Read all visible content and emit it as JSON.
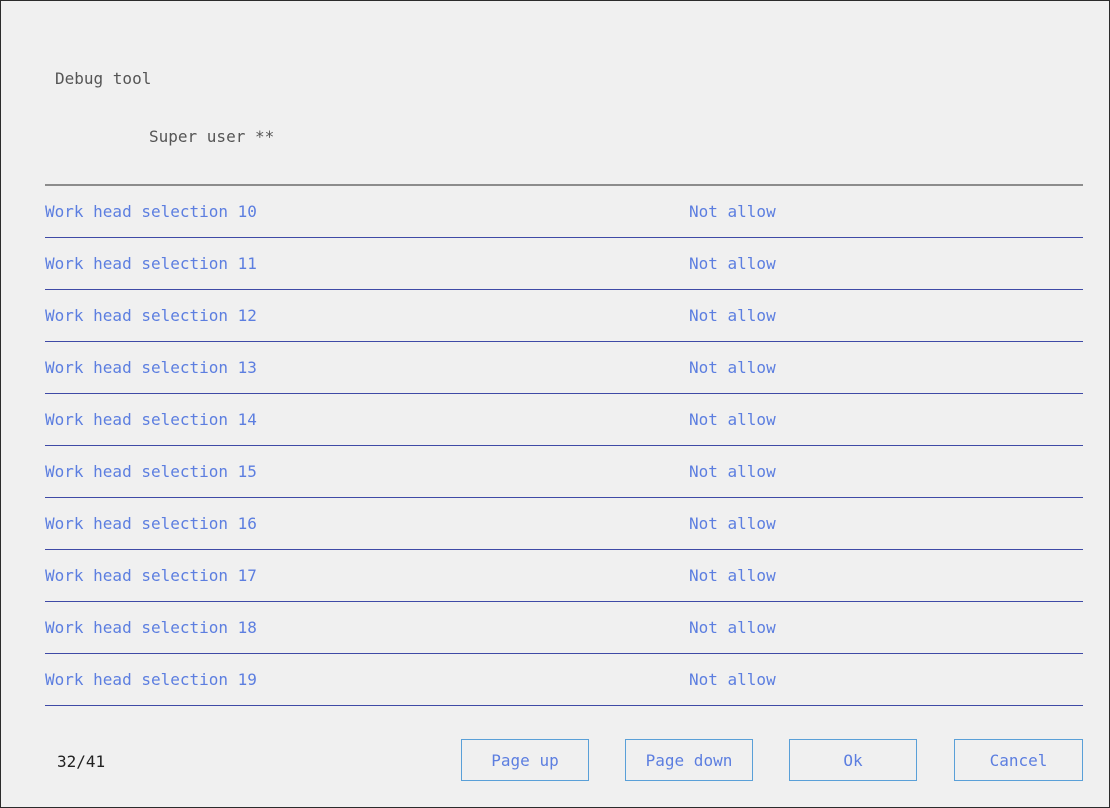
{
  "header": {
    "title": "Debug tool",
    "user_label": "Super user **"
  },
  "rows": [
    {
      "label": "Work head selection 10",
      "value": "Not allow"
    },
    {
      "label": "Work head selection 11",
      "value": "Not allow"
    },
    {
      "label": "Work head selection 12",
      "value": "Not allow"
    },
    {
      "label": "Work head selection 13",
      "value": "Not allow"
    },
    {
      "label": "Work head selection 14",
      "value": "Not allow"
    },
    {
      "label": "Work head selection 15",
      "value": "Not allow"
    },
    {
      "label": "Work head selection 16",
      "value": "Not allow"
    },
    {
      "label": "Work head selection 17",
      "value": "Not allow"
    },
    {
      "label": "Work head selection 18",
      "value": "Not allow"
    },
    {
      "label": "Work head selection 19",
      "value": "Not allow"
    }
  ],
  "footer": {
    "page_indicator": "32/41",
    "page_up_label": "Page up",
    "page_down_label": "Page down",
    "ok_label": "Ok",
    "cancel_label": "Cancel"
  },
  "colors": {
    "background": "#f0f0f0",
    "row_text": "#5c7ee0",
    "row_divider": "#3f4aa6",
    "button_border": "#5aa0d8"
  }
}
